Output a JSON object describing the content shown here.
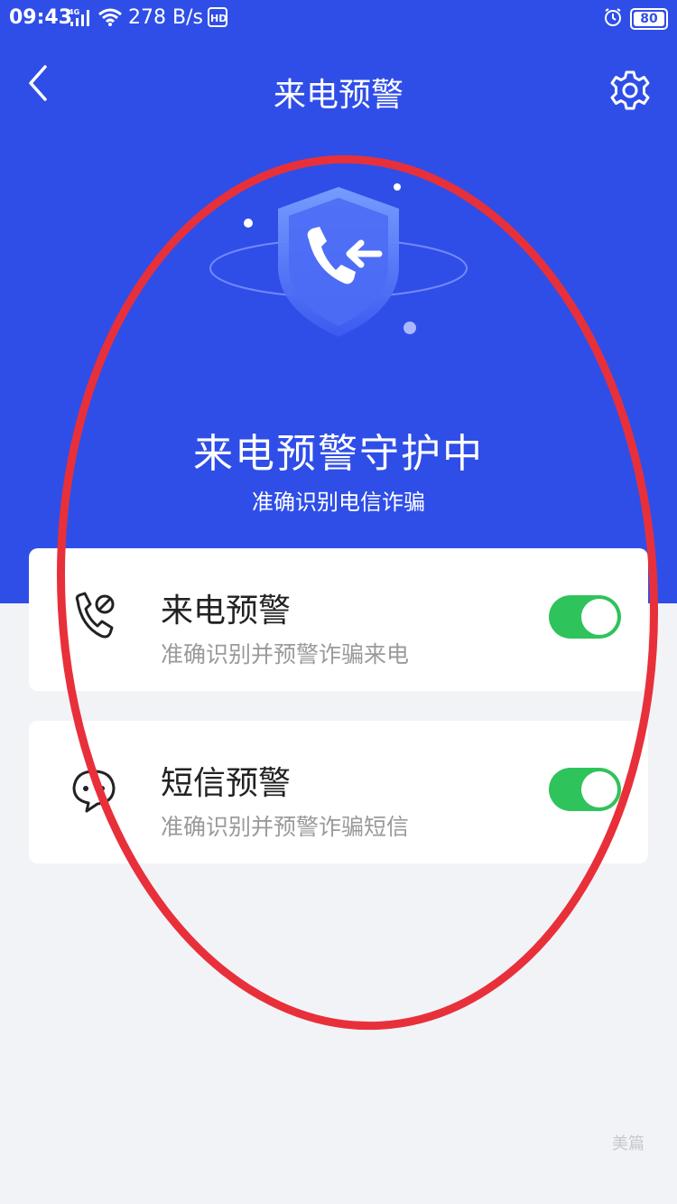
{
  "status_bar": {
    "time": "09:43",
    "network": "4G",
    "speed": "278 B/s",
    "hd": "HD",
    "battery": "80"
  },
  "header": {
    "title": "来电预警"
  },
  "hero": {
    "title": "来电预警守护中",
    "subtitle": "准确识别电信诈骗"
  },
  "features": [
    {
      "title": "来电预警",
      "desc": "准确识别并预警诈骗来电",
      "icon": "phone-block-icon",
      "enabled": true
    },
    {
      "title": "短信预警",
      "desc": "准确识别并预警诈骗短信",
      "icon": "chat-bubble-icon",
      "enabled": true
    }
  ],
  "watermark": "美篇",
  "colors": {
    "brand_blue": "#2f4ee8",
    "toggle_on": "#2fc35b",
    "annotation_red": "#e8303a"
  }
}
